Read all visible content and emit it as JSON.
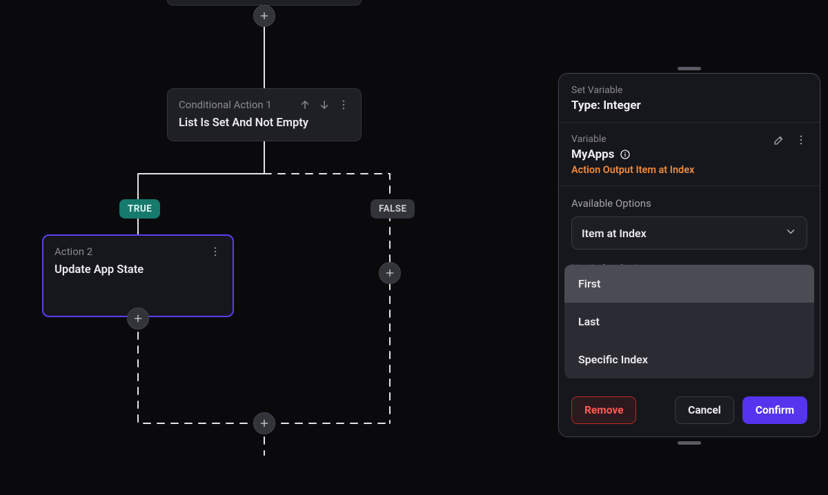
{
  "flow": {
    "partial_node": true,
    "conditional": {
      "eyebrow": "Conditional Action 1",
      "title": "List Is Set And Not Empty"
    },
    "true_badge": "TRUE",
    "false_badge": "FALSE",
    "action2": {
      "eyebrow": "Action 2",
      "title": "Update App State"
    }
  },
  "panel": {
    "eyebrow": "Set Variable",
    "heading": "Type: Integer",
    "variable_label": "Variable",
    "variable_name": "MyApps",
    "variable_sub": "Action Output Item at Index",
    "available_label": "Available Options",
    "selected_option": "Item at Index",
    "truncated_label": "List Index Options",
    "dropdown": [
      "First",
      "Last",
      "Specific Index"
    ],
    "buttons": {
      "remove": "Remove",
      "cancel": "Cancel",
      "confirm": "Confirm"
    }
  }
}
